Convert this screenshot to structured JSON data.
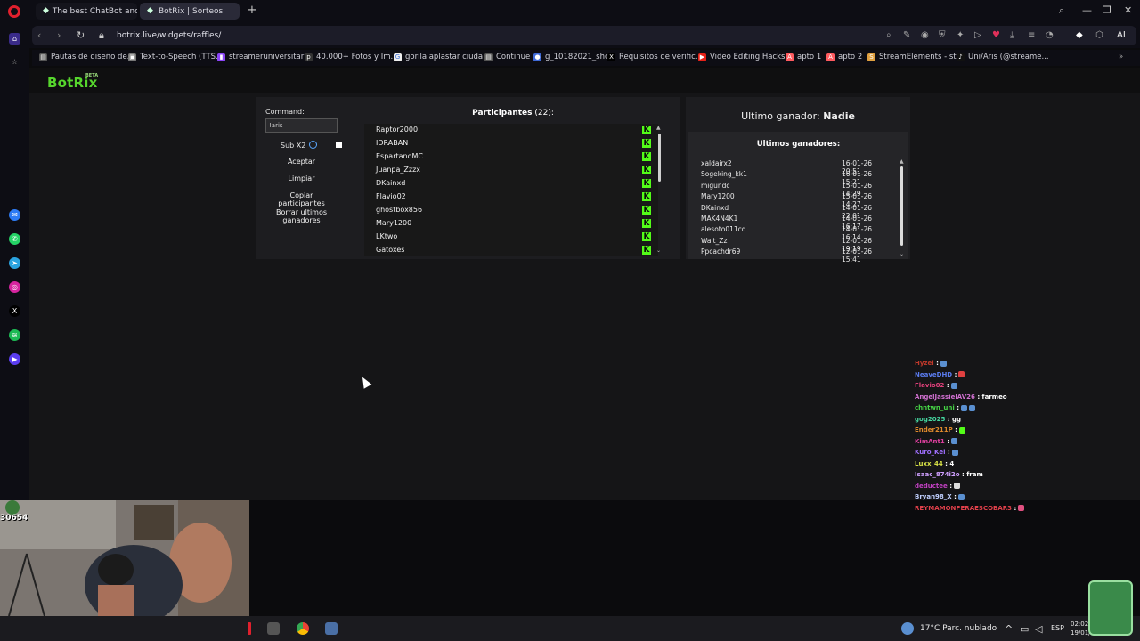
{
  "browser": {
    "tabs": [
      {
        "label": "The best ChatBot and Wi"
      },
      {
        "label": "BotRix | Sorteos"
      }
    ],
    "url": "botrix.live/widgets/raffles/",
    "bookmarks": [
      "Pautas de diseño de...",
      "Text-to-Speech (TTS...",
      "streameruniversitari...",
      "40.000+ Fotos y Im...",
      "gorila aplastar ciuda...",
      "Continue",
      "g_10182021_shcc",
      "Requisitos de verific...",
      "Video Editing Hacks...",
      "apto 1",
      "apto 2",
      "StreamElements - st...",
      "Uni/Aris (@streame..."
    ],
    "ai_label": "AI"
  },
  "site": {
    "brand": "BotRix",
    "beta": "BETA"
  },
  "raffle": {
    "command_label": "Command:",
    "command_value": "!aris",
    "sub_label": "Sub X2",
    "buttons": [
      "Aceptar",
      "Limpiar",
      "Copiar participantes",
      "Borrar ultimos ganadores"
    ],
    "participants_label": "Participantes",
    "participants_count": "(22):",
    "participants": [
      "Raptor2000",
      "IDRABAN",
      "EspartanoMC",
      "Juanpa_Zzzx",
      "DKainxd",
      "Flavio02",
      "ghostbox856",
      "Mary1200",
      "LKtwo",
      "Gatoxes"
    ]
  },
  "winners": {
    "last_winner_label": "Ultimo ganador:",
    "last_winner_value": "Nadie",
    "title": "Ultimos ganadores:",
    "rows": [
      {
        "name": "xaldairx2",
        "date": "16-01-26 20:51"
      },
      {
        "name": "Sogeking_kk1",
        "date": "16-01-26 15:21"
      },
      {
        "name": "migundc",
        "date": "15-01-26 14:29"
      },
      {
        "name": "Mary1200",
        "date": "15-01-26 14:27"
      },
      {
        "name": "DKainxd",
        "date": "14-01-26 22:01"
      },
      {
        "name": "MAK4N4K1",
        "date": "14-01-26 16:17"
      },
      {
        "name": "alesoto011cd",
        "date": "14-01-26 16:14"
      },
      {
        "name": "Walt_Zz",
        "date": "12-01-26 19:19"
      },
      {
        "name": "Ppcachdr69",
        "date": "12-01-26 15:41"
      }
    ]
  },
  "chat": [
    {
      "user": "Hyzel",
      "msg": ":",
      "color": "#c0392b"
    },
    {
      "user": "NeaveDHD",
      "msg": ":",
      "color": "#5b7cf0"
    },
    {
      "user": "Flavio02",
      "msg": ":",
      "color": "#e0407a"
    },
    {
      "user": "AngelJassielAV26",
      "msg": ": farmeo",
      "color": "#d070d0"
    },
    {
      "user": "chntwn_uni",
      "msg": ":",
      "color": "#46d646"
    },
    {
      "user": "gog2025",
      "msg": ": gg",
      "color": "#46d6a0"
    },
    {
      "user": "Ender211P",
      "msg": ":",
      "color": "#e08a2c"
    },
    {
      "user": "KimAnt1",
      "msg": ":",
      "color": "#e040a0"
    },
    {
      "user": "Kuro_Kel",
      "msg": ":",
      "color": "#a070ff"
    },
    {
      "user": "Luxx_44",
      "msg": ": 4",
      "color": "#d6e046"
    },
    {
      "user": "Isaac_874i2o",
      "msg": ": fram",
      "color": "#d0a0ff"
    },
    {
      "user": "deductee",
      "msg": ":",
      "color": "#c040c0"
    },
    {
      "user": "Bryan98_X",
      "msg": ":",
      "color": "#c0d0ff"
    },
    {
      "user": "REYMAMONPERAESCOBAR3",
      "msg": ":",
      "color": "#e0404a"
    }
  ],
  "webcam": {
    "counter": "30654"
  },
  "taskbar": {
    "weather": "17°C  Parc. nublado",
    "lang": "ESP",
    "time": "02:02",
    "date": "19/01/"
  },
  "colors": {
    "brand": "#56d62d",
    "kick": "#53fc18",
    "info": "#5ba8ff"
  }
}
